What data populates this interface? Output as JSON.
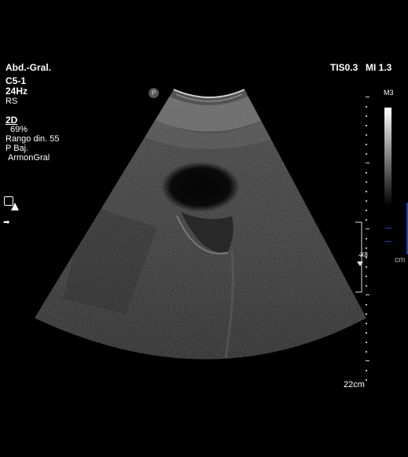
{
  "header": {
    "preset": "Abd.-Gral.",
    "probe": "C5-1",
    "frame_rate": "24Hz",
    "mode_rs": "RS",
    "tis": "TIS0.3",
    "mi": "MI 1.3"
  },
  "params": {
    "mode": "2D",
    "gain": "69%",
    "dynamic_range": "Rango din. 55",
    "power": "P Baj.",
    "harmonic": "ArmonGral"
  },
  "scale": {
    "map_label": "M3",
    "unit": "cm",
    "zoom_marker": "X8",
    "depth": "22cm"
  },
  "icons": {
    "orientation": "P"
  },
  "colors": {
    "background": "#000000",
    "text": "#ffffff",
    "scale_blue": "#1a3fbf"
  }
}
